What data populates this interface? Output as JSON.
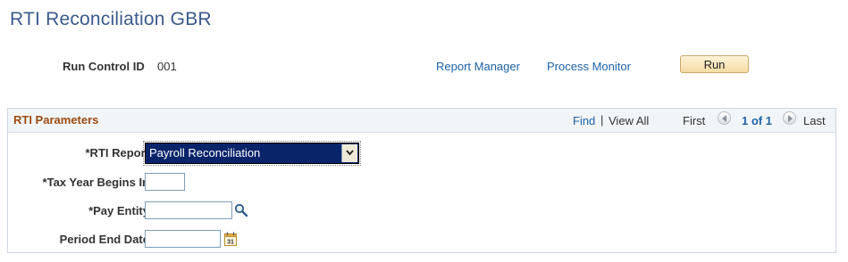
{
  "page": {
    "title": "RTI Reconciliation GBR"
  },
  "run_control": {
    "label": "Run Control ID",
    "value": "001",
    "links": {
      "report_manager": "Report Manager",
      "process_monitor": "Process Monitor"
    },
    "run_label": "Run"
  },
  "group": {
    "title": "RTI Parameters",
    "nav": {
      "find": "Find",
      "separator": "|",
      "view_all": "View All",
      "first": "First",
      "count": "1 of 1",
      "last": "Last"
    }
  },
  "fields": {
    "rti_report": {
      "label": "*RTI Report",
      "value": "Payroll Reconciliation"
    },
    "tax_year": {
      "label": "*Tax Year Begins In",
      "value": ""
    },
    "pay_entity": {
      "label": "*Pay Entity",
      "value": ""
    },
    "period_end": {
      "label": "Period End Date",
      "value": ""
    }
  },
  "icons": {
    "lookup": "magnifier-icon",
    "calendar": "calendar-icon",
    "prev": "left-arrow-icon",
    "next": "right-arrow-icon",
    "dropdown": "chevron-down-icon"
  },
  "colors": {
    "title": "#3b5a8d",
    "link": "#1d62a8",
    "group_title": "#9b4b12",
    "select_highlight": "#0a246a"
  }
}
